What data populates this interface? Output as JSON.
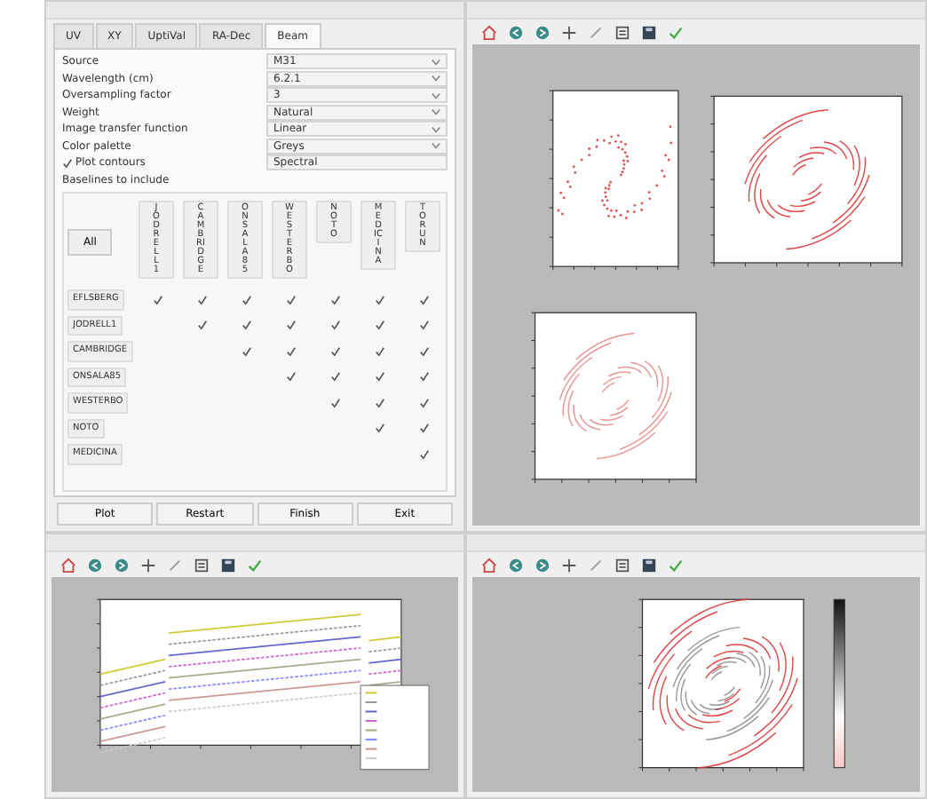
{
  "control_window": {
    "tabs": [
      {
        "label": "UV",
        "selected": false
      },
      {
        "label": "XY",
        "selected": false
      },
      {
        "label": "UptiVal",
        "selected": false
      },
      {
        "label": "RA-Dec",
        "selected": false
      },
      {
        "label": "Beam",
        "selected": true
      }
    ],
    "settings": [
      {
        "label": "Source",
        "value": "M31"
      },
      {
        "label": "Wavelength (cm)",
        "value": "6.2.1"
      },
      {
        "label": "Oversampling factor",
        "value": "3"
      },
      {
        "label": "Weight",
        "value": "Natural"
      },
      {
        "label": "Image transfer function",
        "value": "Linear"
      },
      {
        "label": "Color palette",
        "value": "Greys"
      }
    ],
    "plot_contours": {
      "label": "Plot contours",
      "checked": true,
      "value": "Spectral"
    },
    "baselines_label": "Baselines to include",
    "all_button": "All",
    "columns": [
      "JODRELL1",
      "CAMBRIDGE",
      "ONSALA85",
      "WESTERBO",
      "NOTO",
      "MEDICINA",
      "TORUN"
    ],
    "rows": [
      {
        "label": "EFLSBERG",
        "checks": [
          true,
          true,
          true,
          true,
          true,
          true,
          true
        ]
      },
      {
        "label": "JODRELL1",
        "checks": [
          false,
          true,
          true,
          true,
          true,
          true,
          true
        ]
      },
      {
        "label": "CAMBRIDGE",
        "checks": [
          false,
          false,
          true,
          true,
          true,
          true,
          true
        ]
      },
      {
        "label": "ONSALA85",
        "checks": [
          false,
          false,
          false,
          true,
          true,
          true,
          true
        ]
      },
      {
        "label": "WESTERBO",
        "checks": [
          false,
          false,
          false,
          false,
          true,
          true,
          true
        ]
      },
      {
        "label": "NOTO",
        "checks": [
          false,
          false,
          false,
          false,
          false,
          true,
          true
        ]
      },
      {
        "label": "MEDICINA",
        "checks": [
          false,
          false,
          false,
          false,
          false,
          false,
          true
        ]
      }
    ],
    "buttons": [
      "Plot",
      "Restart",
      "Finish",
      "Exit"
    ]
  },
  "plot_windows": [
    {
      "kind": "panels"
    },
    {
      "kind": "lines"
    },
    {
      "kind": "image"
    }
  ]
}
